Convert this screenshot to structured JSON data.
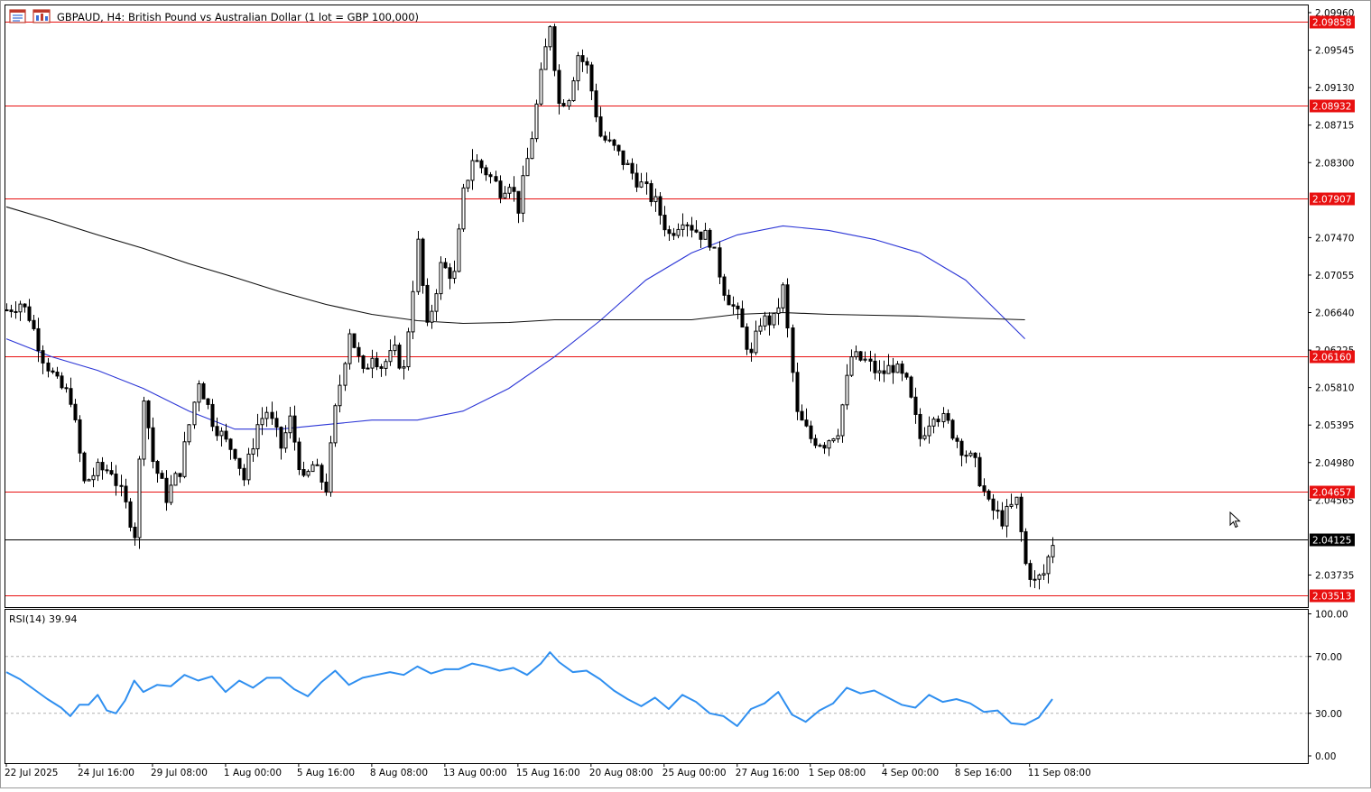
{
  "window": {
    "title": "GBPAUD, H4:  British Pound vs Australian Dollar (1 lot = GBP 100,000)",
    "icons": [
      "chart-window-icon",
      "chart-properties-icon"
    ]
  },
  "price_axis": {
    "ticks": [
      "2.09960",
      "2.09545",
      "2.09130",
      "2.08715",
      "2.08300",
      "2.07470",
      "2.07055",
      "2.06640",
      "2.06225",
      "2.05810",
      "2.05395",
      "2.04980",
      "2.04565",
      "2.03735"
    ],
    "tick_values": [
      2.0996,
      2.09545,
      2.0913,
      2.08715,
      2.083,
      2.0747,
      2.07055,
      2.0664,
      2.06225,
      2.0581,
      2.05395,
      2.0498,
      2.04565,
      2.03735
    ]
  },
  "levels": [
    {
      "label": "2.09858",
      "value": 2.09858
    },
    {
      "label": "2.08932",
      "value": 2.08932
    },
    {
      "label": "2.07907",
      "value": 2.07907
    },
    {
      "label": "2.06160",
      "value": 2.0616
    },
    {
      "label": "2.04657",
      "value": 2.04657
    },
    {
      "label": "2.03513",
      "value": 2.03513
    }
  ],
  "current_price": {
    "label": "2.04125",
    "value": 2.04125
  },
  "time_axis": [
    "22 Jul 2025",
    "24 Jul 16:00",
    "29 Jul 08:00",
    "1 Aug 00:00",
    "5 Aug 16:00",
    "8 Aug 08:00",
    "13 Aug 00:00",
    "15 Aug 16:00",
    "20 Aug 08:00",
    "25 Aug 00:00",
    "27 Aug 16:00",
    "1 Sep 08:00",
    "4 Sep 00:00",
    "8 Sep 16:00",
    "11 Sep 08:00"
  ],
  "rsi_panel": {
    "label": "RSI(14) 39.94",
    "ticks": [
      "100.00",
      "70.00",
      "30.00",
      "0.00"
    ],
    "tick_values": [
      100,
      70,
      30,
      0
    ]
  },
  "colors": {
    "level_line": "#e81010",
    "level_tag": "#e81010",
    "current_tag": "#000000",
    "ma_fast": "#2b35d6",
    "ma_slow": "#111111",
    "rsi_line": "#2f8ff0",
    "candle": "#000000"
  },
  "chart_data": [
    {
      "type": "candlestick",
      "symbol": "GBPAUD",
      "timeframe": "H4",
      "ylim": [
        2.0338,
        2.1004
      ],
      "x_tick_labels": [
        "22 Jul 2025",
        "24 Jul 16:00",
        "29 Jul 08:00",
        "1 Aug 00:00",
        "5 Aug 16:00",
        "8 Aug 08:00",
        "13 Aug 00:00",
        "15 Aug 16:00",
        "20 Aug 08:00",
        "25 Aug 00:00",
        "27 Aug 16:00",
        "1 Sep 08:00",
        "4 Sep 00:00",
        "8 Sep 16:00",
        "11 Sep 08:00"
      ],
      "close_path": [
        [
          0,
          2.0667
        ],
        [
          3,
          2.0675
        ],
        [
          5,
          2.066
        ],
        [
          8,
          2.0615
        ],
        [
          11,
          2.0585
        ],
        [
          14,
          2.057
        ],
        [
          17,
          2.0475
        ],
        [
          20,
          2.049
        ],
        [
          23,
          2.049
        ],
        [
          26,
          2.045
        ],
        [
          28,
          2.042
        ],
        [
          30,
          2.0575
        ],
        [
          32,
          2.05
        ],
        [
          35,
          2.046
        ],
        [
          38,
          2.049
        ],
        [
          40,
          2.054
        ],
        [
          42,
          2.059
        ],
        [
          45,
          2.0545
        ],
        [
          48,
          2.052
        ],
        [
          50,
          2.051
        ],
        [
          52,
          2.048
        ],
        [
          55,
          2.054
        ],
        [
          57,
          2.0555
        ],
        [
          60,
          2.0515
        ],
        [
          62,
          2.0545
        ],
        [
          65,
          2.0475
        ],
        [
          67,
          2.0495
        ],
        [
          70,
          2.047
        ],
        [
          72,
          2.0555
        ],
        [
          75,
          2.0645
        ],
        [
          78,
          2.0595
        ],
        [
          80,
          2.062
        ],
        [
          82,
          2.0605
        ],
        [
          85,
          2.062
        ],
        [
          87,
          2.06
        ],
        [
          90,
          2.074
        ],
        [
          92,
          2.0645
        ],
        [
          95,
          2.0715
        ],
        [
          98,
          2.0705
        ],
        [
          100,
          2.0795
        ],
        [
          102,
          2.0835
        ],
        [
          105,
          2.082
        ],
        [
          108,
          2.08
        ],
        [
          110,
          2.081
        ],
        [
          112,
          2.078
        ],
        [
          115,
          2.086
        ],
        [
          117,
          2.0925
        ],
        [
          119,
          2.0985
        ],
        [
          121,
          2.0895
        ],
        [
          123,
          2.0905
        ],
        [
          125,
          2.095
        ],
        [
          127,
          2.0935
        ],
        [
          130,
          2.086
        ],
        [
          133,
          2.0845
        ],
        [
          136,
          2.0825
        ],
        [
          139,
          2.0805
        ],
        [
          142,
          2.0785
        ],
        [
          145,
          2.075
        ],
        [
          148,
          2.077
        ],
        [
          151,
          2.0755
        ],
        [
          154,
          2.0745
        ],
        [
          157,
          2.069
        ],
        [
          160,
          2.066
        ],
        [
          163,
          2.0615
        ],
        [
          165,
          2.0655
        ],
        [
          168,
          2.0655
        ],
        [
          170,
          2.069
        ],
        [
          173,
          2.055
        ],
        [
          176,
          2.0525
        ],
        [
          179,
          2.052
        ],
        [
          182,
          2.0535
        ],
        [
          185,
          2.0615
        ],
        [
          188,
          2.061
        ],
        [
          191,
          2.0595
        ],
        [
          194,
          2.0605
        ],
        [
          197,
          2.0585
        ],
        [
          200,
          2.0525
        ],
        [
          203,
          2.0555
        ],
        [
          206,
          2.054
        ],
        [
          209,
          2.0515
        ],
        [
          212,
          2.0495
        ],
        [
          215,
          2.045
        ],
        [
          218,
          2.0435
        ],
        [
          221,
          2.0455
        ],
        [
          223,
          2.0385
        ],
        [
          225,
          2.0365
        ],
        [
          227,
          2.0375
        ],
        [
          229,
          2.041
        ]
      ],
      "moving_averages": [
        {
          "kind": "fast",
          "path": [
            [
              0,
              2.0635
            ],
            [
              10,
              2.0615
            ],
            [
              20,
              2.06
            ],
            [
              30,
              2.058
            ],
            [
              40,
              2.0555
            ],
            [
              50,
              2.0535
            ],
            [
              60,
              2.0535
            ],
            [
              70,
              2.054
            ],
            [
              80,
              2.0545
            ],
            [
              90,
              2.0545
            ],
            [
              100,
              2.0555
            ],
            [
              110,
              2.058
            ],
            [
              120,
              2.0615
            ],
            [
              130,
              2.0655
            ],
            [
              140,
              2.07
            ],
            [
              150,
              2.073
            ],
            [
              160,
              2.075
            ],
            [
              170,
              2.076
            ],
            [
              180,
              2.0755
            ],
            [
              190,
              2.0745
            ],
            [
              200,
              2.073
            ],
            [
              210,
              2.07
            ],
            [
              217,
              2.0665
            ],
            [
              223,
              2.0635
            ]
          ]
        },
        {
          "kind": "slow",
          "path": [
            [
              0,
              2.0781
            ],
            [
              10,
              2.0766
            ],
            [
              20,
              2.075
            ],
            [
              30,
              2.0735
            ],
            [
              40,
              2.0718
            ],
            [
              50,
              2.0703
            ],
            [
              60,
              2.0687
            ],
            [
              70,
              2.0673
            ],
            [
              80,
              2.0662
            ],
            [
              90,
              2.0655
            ],
            [
              100,
              2.0652
            ],
            [
              110,
              2.0653
            ],
            [
              120,
              2.0656
            ],
            [
              130,
              2.0656
            ],
            [
              140,
              2.0656
            ],
            [
              150,
              2.0656
            ],
            [
              160,
              2.0662
            ],
            [
              170,
              2.0664
            ],
            [
              180,
              2.0662
            ],
            [
              190,
              2.0661
            ],
            [
              200,
              2.066
            ],
            [
              210,
              2.0658
            ],
            [
              223,
              2.0656
            ]
          ]
        }
      ]
    },
    {
      "type": "line",
      "title": "RSI(14) 39.94",
      "ylim": [
        0,
        100
      ],
      "reference_lines": [
        70,
        30
      ],
      "path": [
        [
          0,
          59
        ],
        [
          3,
          54
        ],
        [
          6,
          47
        ],
        [
          9,
          40
        ],
        [
          12,
          34
        ],
        [
          14,
          28
        ],
        [
          16,
          36
        ],
        [
          18,
          36
        ],
        [
          20,
          43
        ],
        [
          22,
          32
        ],
        [
          24,
          30
        ],
        [
          26,
          39
        ],
        [
          28,
          53
        ],
        [
          30,
          45
        ],
        [
          33,
          50
        ],
        [
          36,
          49
        ],
        [
          39,
          57
        ],
        [
          42,
          53
        ],
        [
          45,
          56
        ],
        [
          48,
          45
        ],
        [
          51,
          53
        ],
        [
          54,
          48
        ],
        [
          57,
          55
        ],
        [
          60,
          55
        ],
        [
          63,
          47
        ],
        [
          66,
          42
        ],
        [
          69,
          52
        ],
        [
          72,
          60
        ],
        [
          75,
          50
        ],
        [
          78,
          55
        ],
        [
          81,
          57
        ],
        [
          84,
          59
        ],
        [
          87,
          57
        ],
        [
          90,
          63
        ],
        [
          93,
          58
        ],
        [
          96,
          61
        ],
        [
          99,
          61
        ],
        [
          102,
          65
        ],
        [
          105,
          63
        ],
        [
          108,
          60
        ],
        [
          111,
          62
        ],
        [
          114,
          57
        ],
        [
          117,
          65
        ],
        [
          119,
          73
        ],
        [
          121,
          66
        ],
        [
          124,
          59
        ],
        [
          127,
          60
        ],
        [
          130,
          54
        ],
        [
          133,
          46
        ],
        [
          136,
          40
        ],
        [
          139,
          35
        ],
        [
          142,
          41
        ],
        [
          145,
          33
        ],
        [
          148,
          43
        ],
        [
          151,
          38
        ],
        [
          154,
          30
        ],
        [
          157,
          28
        ],
        [
          160,
          21
        ],
        [
          163,
          33
        ],
        [
          166,
          37
        ],
        [
          169,
          45
        ],
        [
          172,
          29
        ],
        [
          175,
          24
        ],
        [
          178,
          32
        ],
        [
          181,
          37
        ],
        [
          184,
          48
        ],
        [
          187,
          44
        ],
        [
          190,
          46
        ],
        [
          193,
          41
        ],
        [
          196,
          36
        ],
        [
          199,
          34
        ],
        [
          202,
          43
        ],
        [
          205,
          38
        ],
        [
          208,
          40
        ],
        [
          211,
          37
        ],
        [
          214,
          31
        ],
        [
          217,
          32
        ],
        [
          220,
          23
        ],
        [
          223,
          22
        ],
        [
          226,
          27
        ],
        [
          229,
          40
        ]
      ]
    }
  ]
}
